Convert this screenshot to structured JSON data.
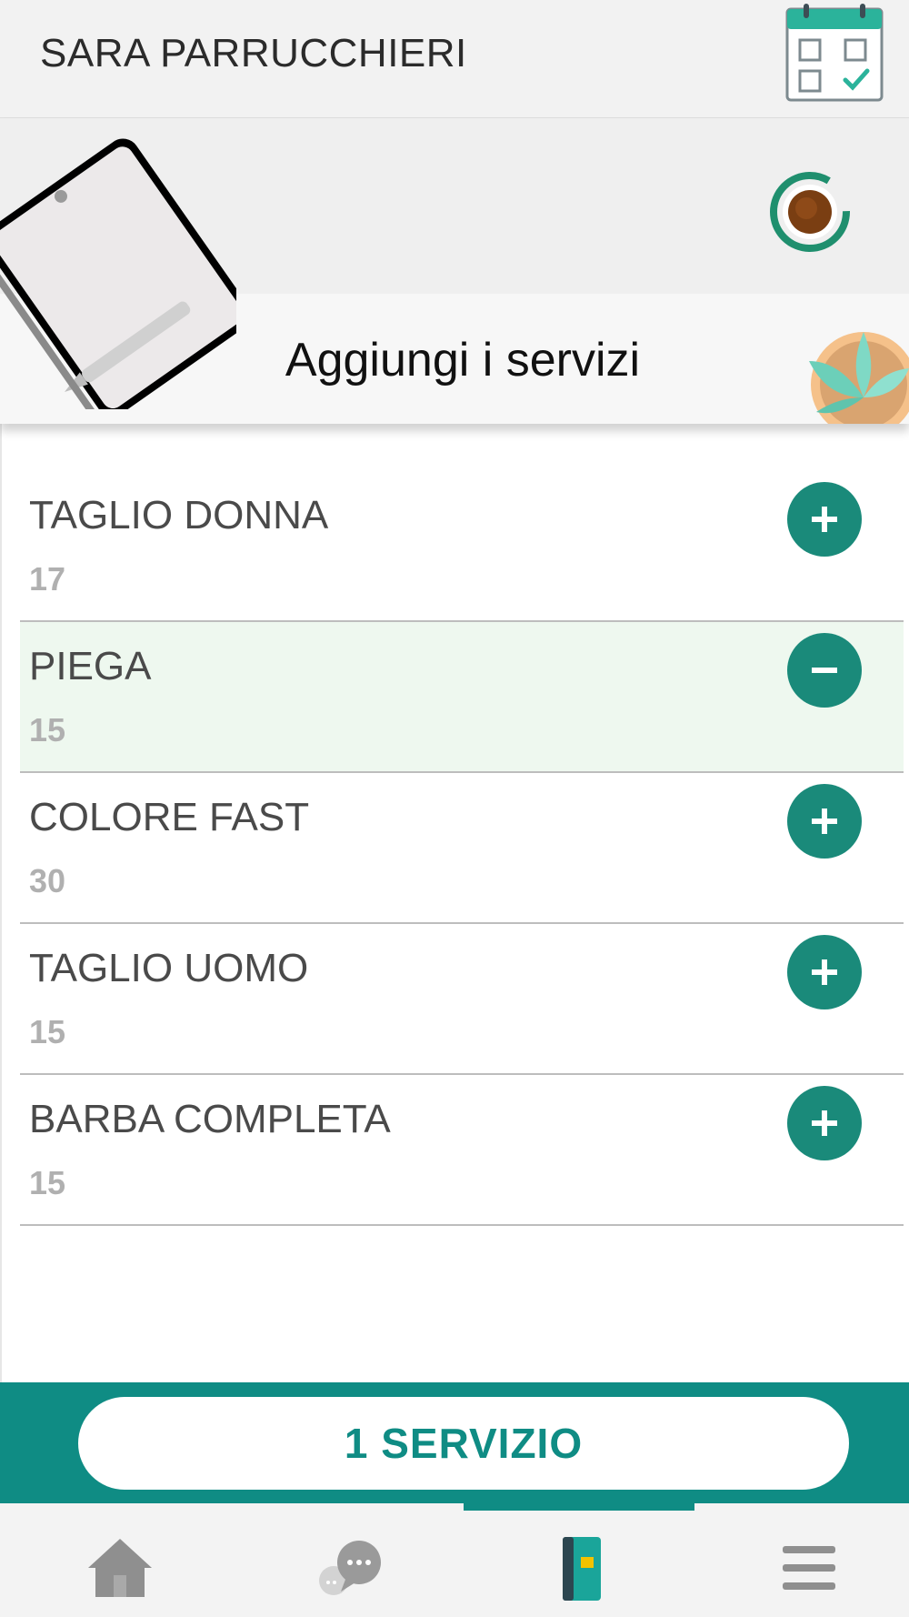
{
  "header": {
    "title": "SARA PARRUCCHIERI",
    "calendar_icon": "calendar-check-icon"
  },
  "banner": {
    "title": "Aggiungi i servizi",
    "illustrations": [
      "tablet-pen-illustration",
      "coffee-cup-illustration",
      "plant-illustration"
    ]
  },
  "services": [
    {
      "name": "TAGLIO DONNA",
      "duration": "17",
      "selected": false,
      "action_icon": "plus-icon"
    },
    {
      "name": "PIEGA",
      "duration": "15",
      "selected": true,
      "action_icon": "minus-icon"
    },
    {
      "name": "COLORE FAST",
      "duration": "30",
      "selected": false,
      "action_icon": "plus-icon"
    },
    {
      "name": "TAGLIO UOMO",
      "duration": "15",
      "selected": false,
      "action_icon": "plus-icon"
    },
    {
      "name": "BARBA COMPLETA",
      "duration": "15",
      "selected": false,
      "action_icon": "plus-icon"
    }
  ],
  "cta": {
    "label": "1 SERVIZIO"
  },
  "tabbar": {
    "items": [
      {
        "icon": "home-icon",
        "active": false
      },
      {
        "icon": "chat-icon",
        "active": false
      },
      {
        "icon": "notebook-icon",
        "active": true
      },
      {
        "icon": "menu-icon",
        "active": false
      }
    ]
  },
  "colors": {
    "accent": "#0f8c84",
    "button": "#1a8a7a",
    "selected_row": "#eef8ef",
    "header_bg": "#f2f2f2"
  }
}
